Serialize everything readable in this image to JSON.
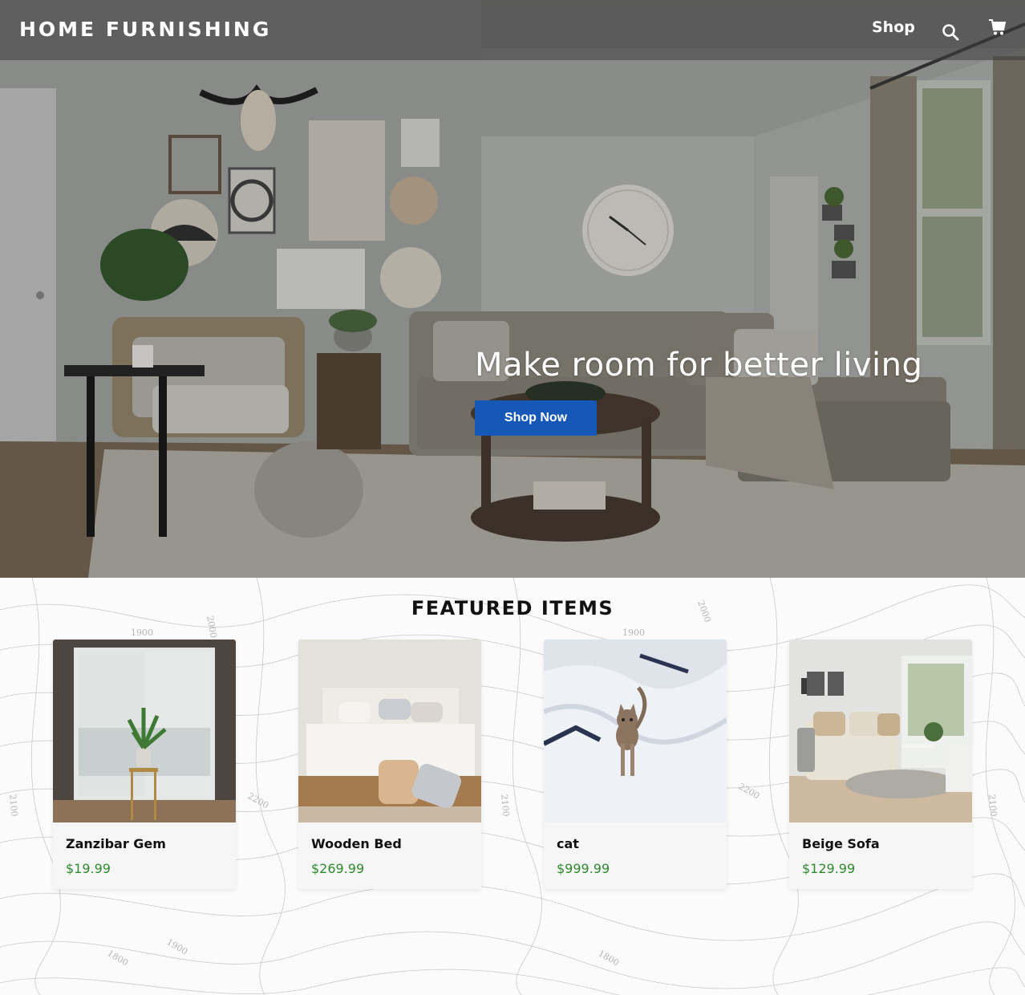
{
  "nav": {
    "brand": "HOME FURNISHING",
    "shop_label": "Shop",
    "search_icon": "search-icon",
    "cart_icon": "cart-icon"
  },
  "hero": {
    "headline": "Make room for better living",
    "cta_label": "Shop Now",
    "cta_color": "#1558b8"
  },
  "featured": {
    "title": "FEATURED ITEMS",
    "price_color": "#2d8a2d",
    "items": [
      {
        "name": "Zanzibar Gem",
        "price": "$19.99"
      },
      {
        "name": "Wooden Bed",
        "price": "$269.99"
      },
      {
        "name": "cat",
        "price": "$999.99"
      },
      {
        "name": "Beige Sofa",
        "price": "$129.99"
      }
    ]
  },
  "background_map_labels": [
    "1900",
    "2000",
    "2100",
    "2200",
    "1800",
    "1900",
    "2100",
    "2000",
    "1900",
    "2100",
    "2200",
    "1800"
  ]
}
